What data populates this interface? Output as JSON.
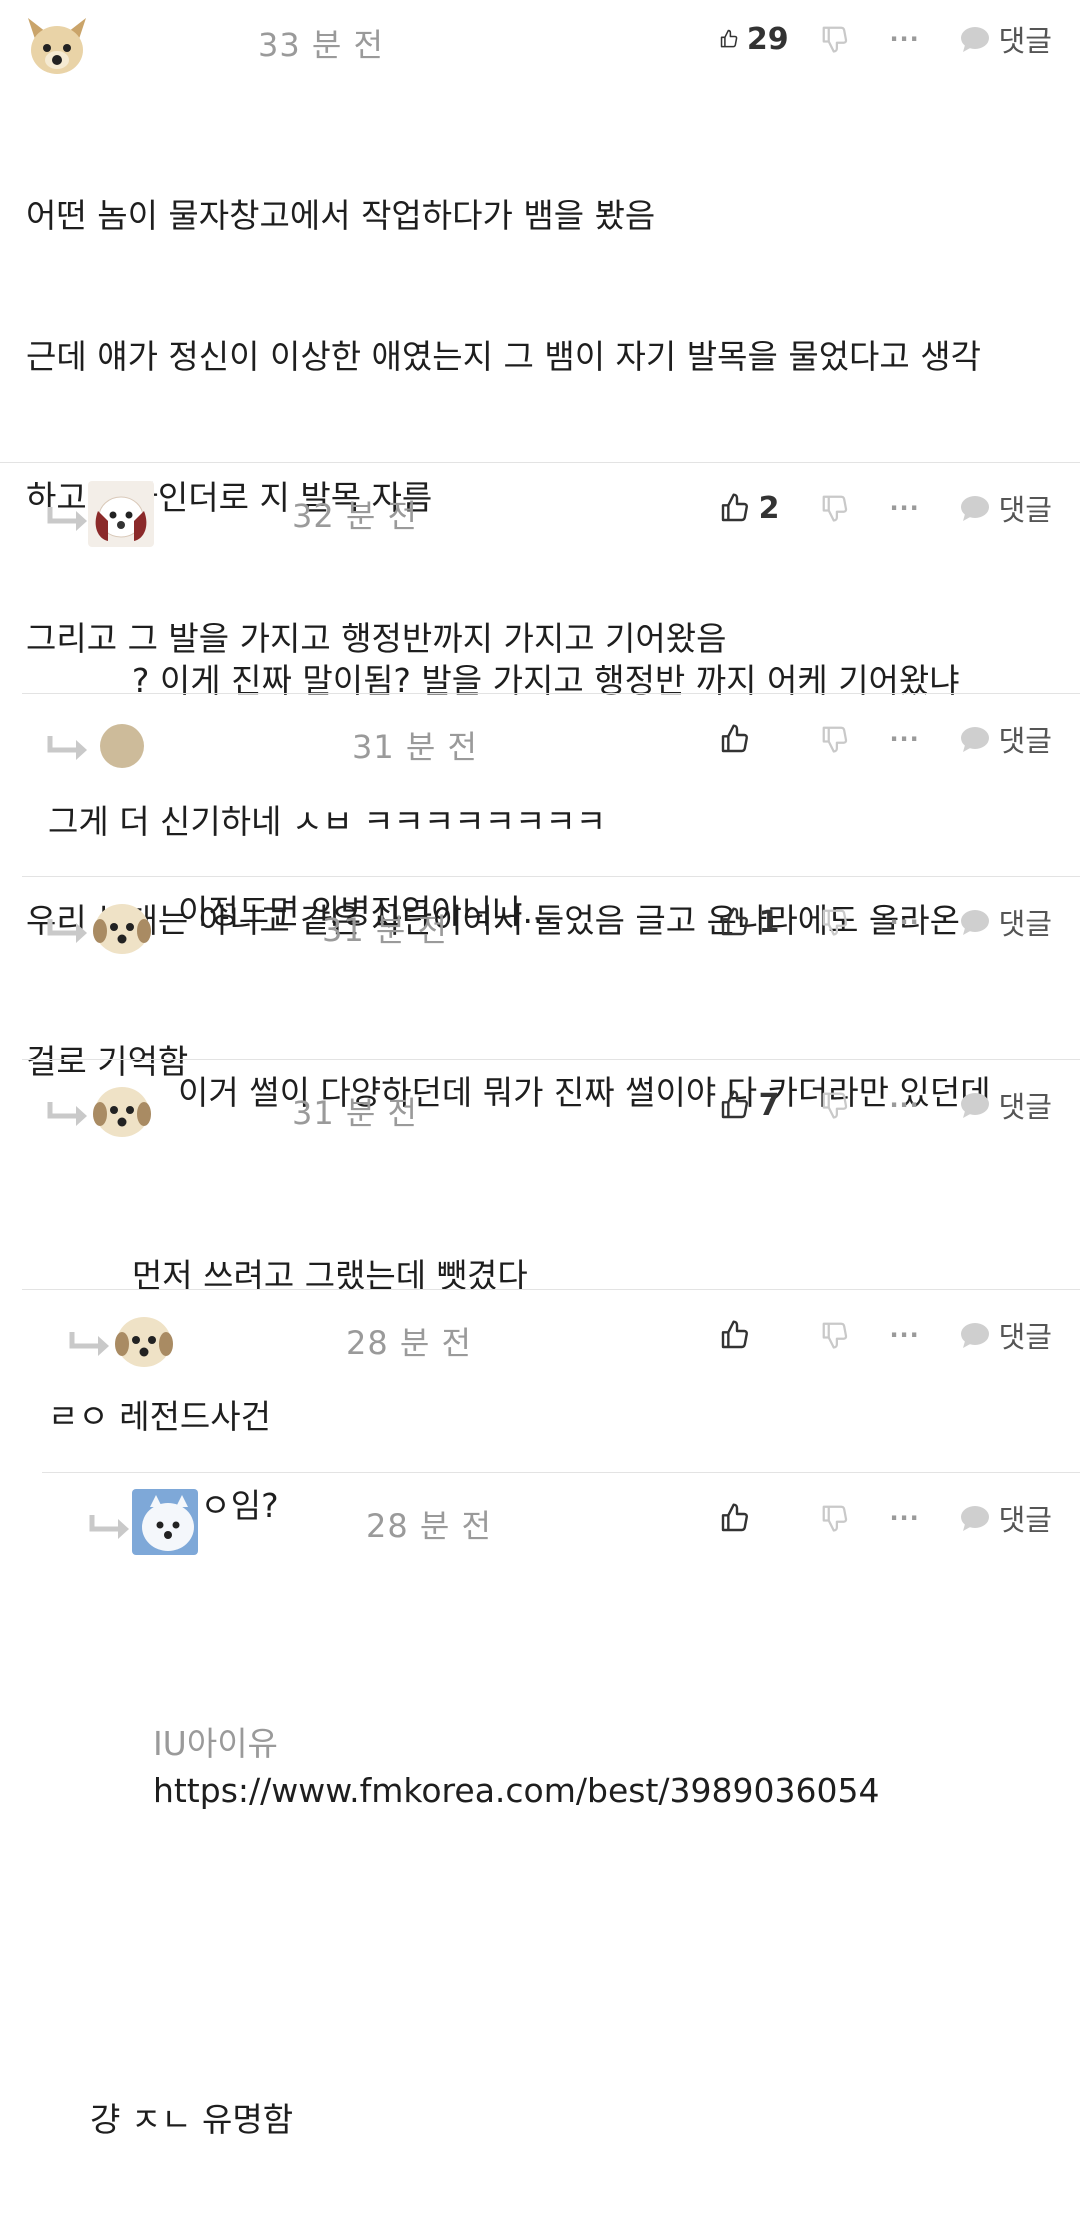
{
  "actions": {
    "reply_label": "댓글",
    "more_label": "···"
  },
  "comments": [
    {
      "time": "33 분 전",
      "likes": "29",
      "lines": [
        "어떤 놈이 물자창고에서 작업하다가 뱀을 봤음",
        "근데 얘가 정신이 이상한 애였는지 그 뱀이 자기 발목을 물었다고 생각",
        "하고 그라인더로 지 발목 자름",
        "그리고 그 발을 가지고 행정반까지 가지고 기어왔음",
        "",
        "우리 부대는 아니고 같은 사단이여서 들었음 글고 온나라에도 올라온",
        "걸로 기억함"
      ]
    },
    {
      "time": "32 분 전",
      "likes": "2",
      "lines": [
        "        ? 이게 진짜 말이됨? 발을 가지고 행정반 까지 어케 기어왔냐",
        "그게 더 신기하네 ㅅㅂ ㅋㅋㅋㅋㅋㅋㅋㅋ"
      ]
    },
    {
      "time": "31 분 전",
      "likes": "",
      "lines": [
        "이정도면 의병전역아니냐..."
      ]
    },
    {
      "time": "31 분 전",
      "likes": "1",
      "lines": [
        "이거 썰이 다양하던데 뭐가 진짜 썰이야 다 카더라만 있던데"
      ]
    },
    {
      "time": "31 분 전",
      "likes": "7",
      "lines": [
        "        먼저 쓰려고 그랬는데 뺏겼다",
        "ㄹㅇ 레전드사건"
      ]
    },
    {
      "time": "28 분 전",
      "likes": "",
      "lines": [
        "ㄹㅇ임?"
      ]
    },
    {
      "time": "28 분 전",
      "likes": "",
      "link_prefix": "IU아이유",
      "link": "https://www.fmkorea.com/best/3989036054",
      "lines": [
        "걍 ㅈㄴ 유명함"
      ]
    }
  ],
  "colors": {
    "text": "#1e1e1e",
    "muted": "#9a9a9a",
    "icon": "#c9c9c9",
    "divider": "#e3e3e3"
  }
}
